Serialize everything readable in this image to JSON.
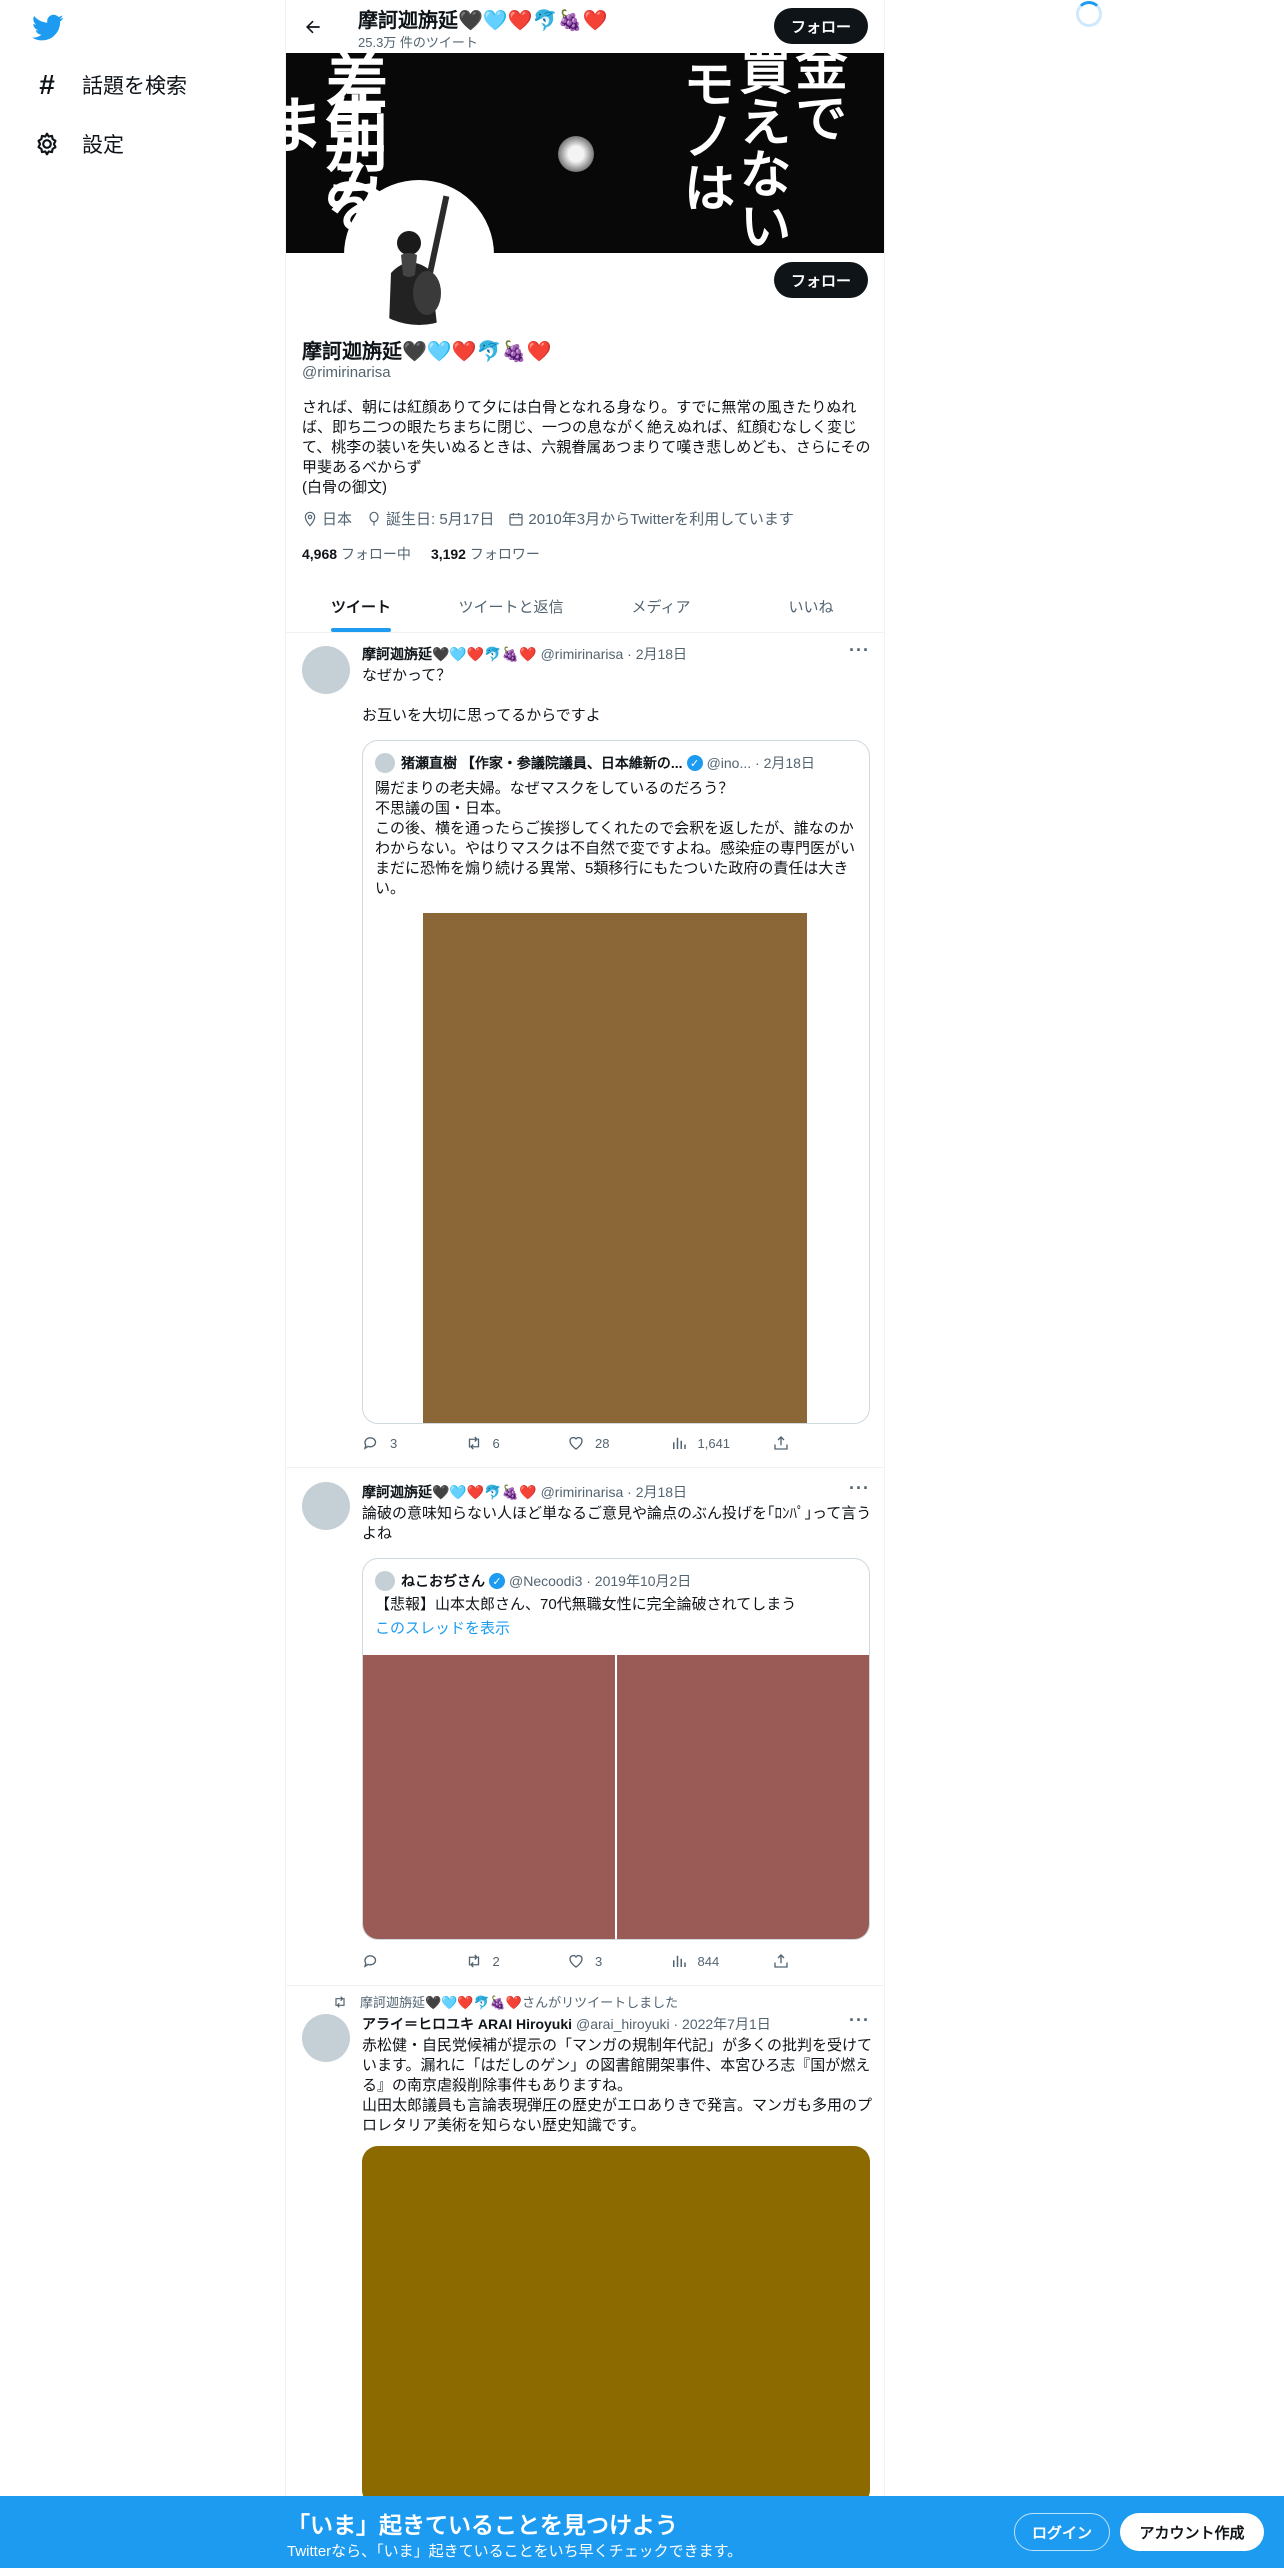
{
  "colors": {
    "accent": "#1d9bf0",
    "text": "#0f1419",
    "muted": "#536471"
  },
  "sidebar": {
    "logo_icon": "twitter-bird-icon",
    "items": [
      {
        "icon": "hashtag-icon",
        "label": "話題を検索"
      },
      {
        "icon": "gear-icon",
        "label": "設定"
      }
    ]
  },
  "header": {
    "name": "摩訶迦旃延🖤🩵❤️🐬🍇❤️",
    "tweet_count": "25.3万 件のツイート",
    "follow_label": "フォロー"
  },
  "banner": {
    "left_text": [
      "差別を",
      "生みま"
    ],
    "right_text": [
      "金で",
      "買えない",
      "モノは"
    ]
  },
  "profile": {
    "name": "摩訶迦旃延🖤🩵❤️🐬🍇❤️",
    "handle": "@rimirinarisa",
    "follow_label": "フォロー",
    "bio": "されば、朝には紅顔ありて夕には白骨となれる身なり。すでに無常の風きたりぬれば、即ち二つの眼たちまちに閉じ、一つの息ながく絶えぬれば、紅顔むなしく変じて、桃李の装いを失いぬるときは、六親眷属あつまりて嘆き悲しめども、さらにその甲斐あるべからず\n(白骨の御文)",
    "location": "日本",
    "birthday": "誕生日: 5月17日",
    "joined": "2010年3月からTwitterを利用しています",
    "following_count": "4,968",
    "following_label": "フォロー中",
    "followers_count": "3,192",
    "followers_label": "フォロワー"
  },
  "tabs": [
    "ツイート",
    "ツイートと返信",
    "メディア",
    "いいね"
  ],
  "tweets": [
    {
      "name": "摩訶迦旃延🖤🩵❤️🐬🍇❤️",
      "handle_date": "@rimirinarisa · 2月18日",
      "text": "なぜかって？\n\nお互いを大切に思ってるからですよ",
      "quote": {
        "name": "猪瀬直樹 【作家・参議院議員、日本維新の...",
        "handle_date": "@ino... · 2月18日",
        "text": "陽だまりの老夫婦。なぜマスクをしているのだろう？\n不思議の国・日本。\nこの後、横を通ったらご挨拶してくれたので会釈を返したが、誰なのかわからない。やはりマスクは不自然で変ですよね。感染症の専門医がいまだに恐怖を煽り続ける異常、5類移行にもたついた政府の責任は大きい。",
        "media_color": "#8b6636"
      },
      "replies": "3",
      "retweets": "6",
      "likes": "28",
      "views": "1,641"
    },
    {
      "name": "摩訶迦旃延🖤🩵❤️🐬🍇❤️",
      "handle_date": "@rimirinarisa · 2月18日",
      "text": "論破の意味知らない人ほど単なるご意見や論点のぶん投げを｢ﾛﾝﾊﾟ｣って言うよね",
      "quote": {
        "name": "ねこおぢさん",
        "handle_date": "@Necoodi3 · 2019年10月2日",
        "text": "【悲報】山本太郎さん、70代無職女性に完全論破されてしまう",
        "link": "このスレッドを表示",
        "media_color": "#9a5a56"
      },
      "replies": "",
      "retweets": "2",
      "likes": "3",
      "views": "844"
    },
    {
      "retweeted_by": "摩訶迦旃延🖤🩵❤️🐬🍇❤️さんがリツイートしました",
      "name": "アライ＝ヒロユキ ARAI Hiroyuki",
      "handle_date": "@arai_hiroyuki · 2022年7月1日",
      "text": "赤松健・自民党候補が提示の「マンガの規制年代記」が多くの批判を受けています。漏れに「はだしのゲン」の図書館開架事件、本宮ひろ志『国が燃える』の南京虐殺削除事件もありますね。\n山田太郎議員も言論表現弾圧の歴史がエロありきで発言。マンガも多用のプロレタリア美術を知らない歴史知識です。",
      "media_color": "#8c6a00"
    }
  ],
  "bottom_banner": {
    "title": "「いま」起きていることを見つけよう",
    "subtitle": "Twitterなら、「いま」起きていることをいち早くチェックできます。",
    "login_label": "ログイン",
    "signup_label": "アカウント作成"
  }
}
